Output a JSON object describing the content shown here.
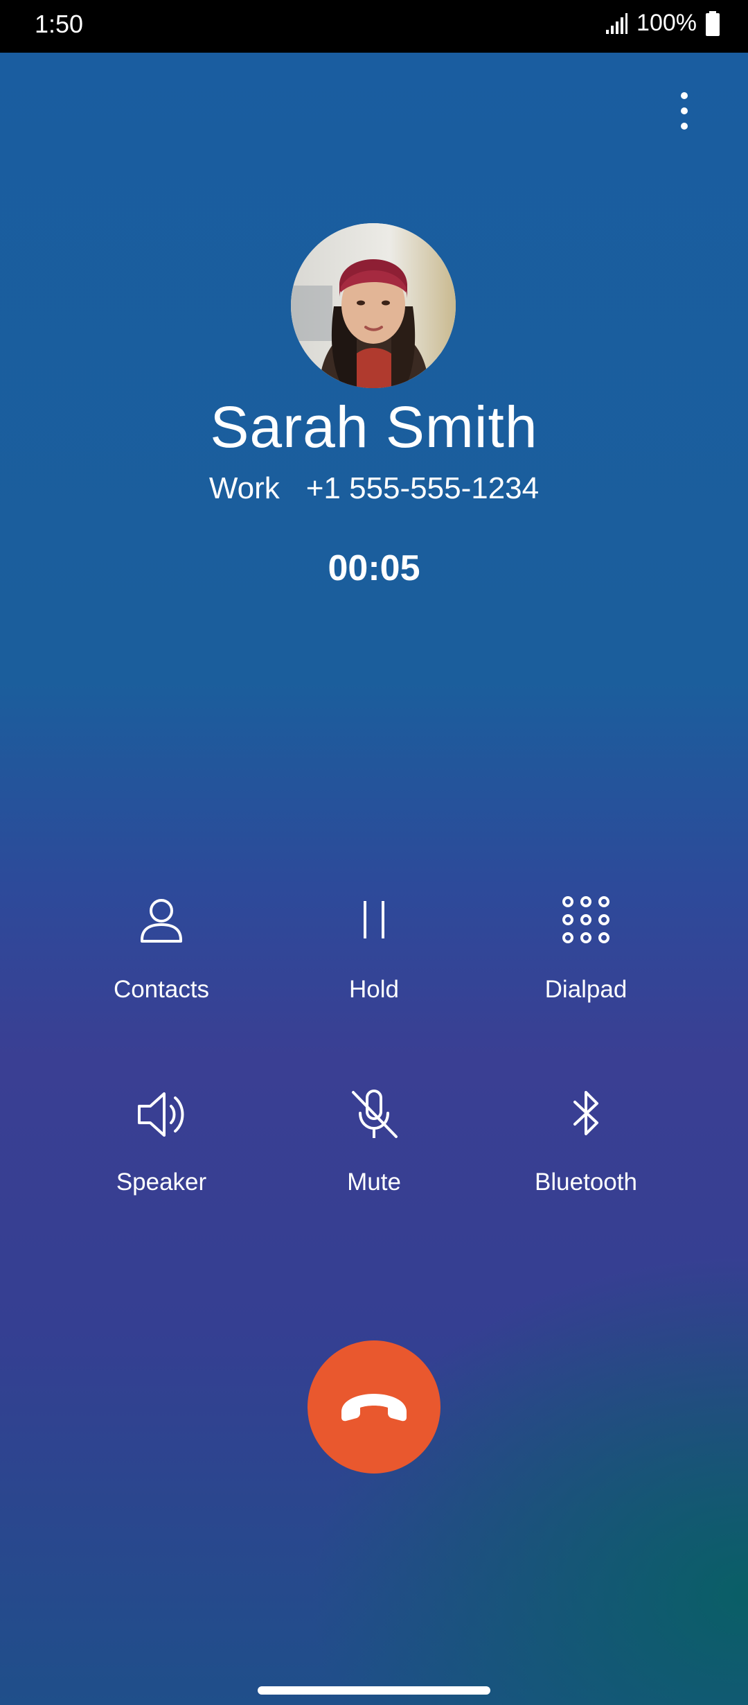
{
  "status_bar": {
    "time": "1:50",
    "battery": "100%",
    "icons": [
      "signal-icon",
      "battery-icon"
    ]
  },
  "header": {
    "overflow_icon": "more-vert-icon"
  },
  "caller": {
    "name": "Sarah Smith",
    "number_label": "Work",
    "number": "+1 555-555-1234",
    "timer": "00:05"
  },
  "actions": [
    {
      "label": "Contacts",
      "icon": "person-icon"
    },
    {
      "label": "Hold",
      "icon": "pause-icon"
    },
    {
      "label": "Dialpad",
      "icon": "dialpad-icon"
    },
    {
      "label": "Speaker",
      "icon": "speaker-icon"
    },
    {
      "label": "Mute",
      "icon": "mic-off-icon"
    },
    {
      "label": "Bluetooth",
      "icon": "bluetooth-icon"
    }
  ],
  "end_call": {
    "icon": "call-end-icon",
    "color": "#e9582e"
  },
  "colors": {
    "background_top": "#1a5da0",
    "background_mid": "#3a3f93",
    "background_teal": "#086064"
  }
}
